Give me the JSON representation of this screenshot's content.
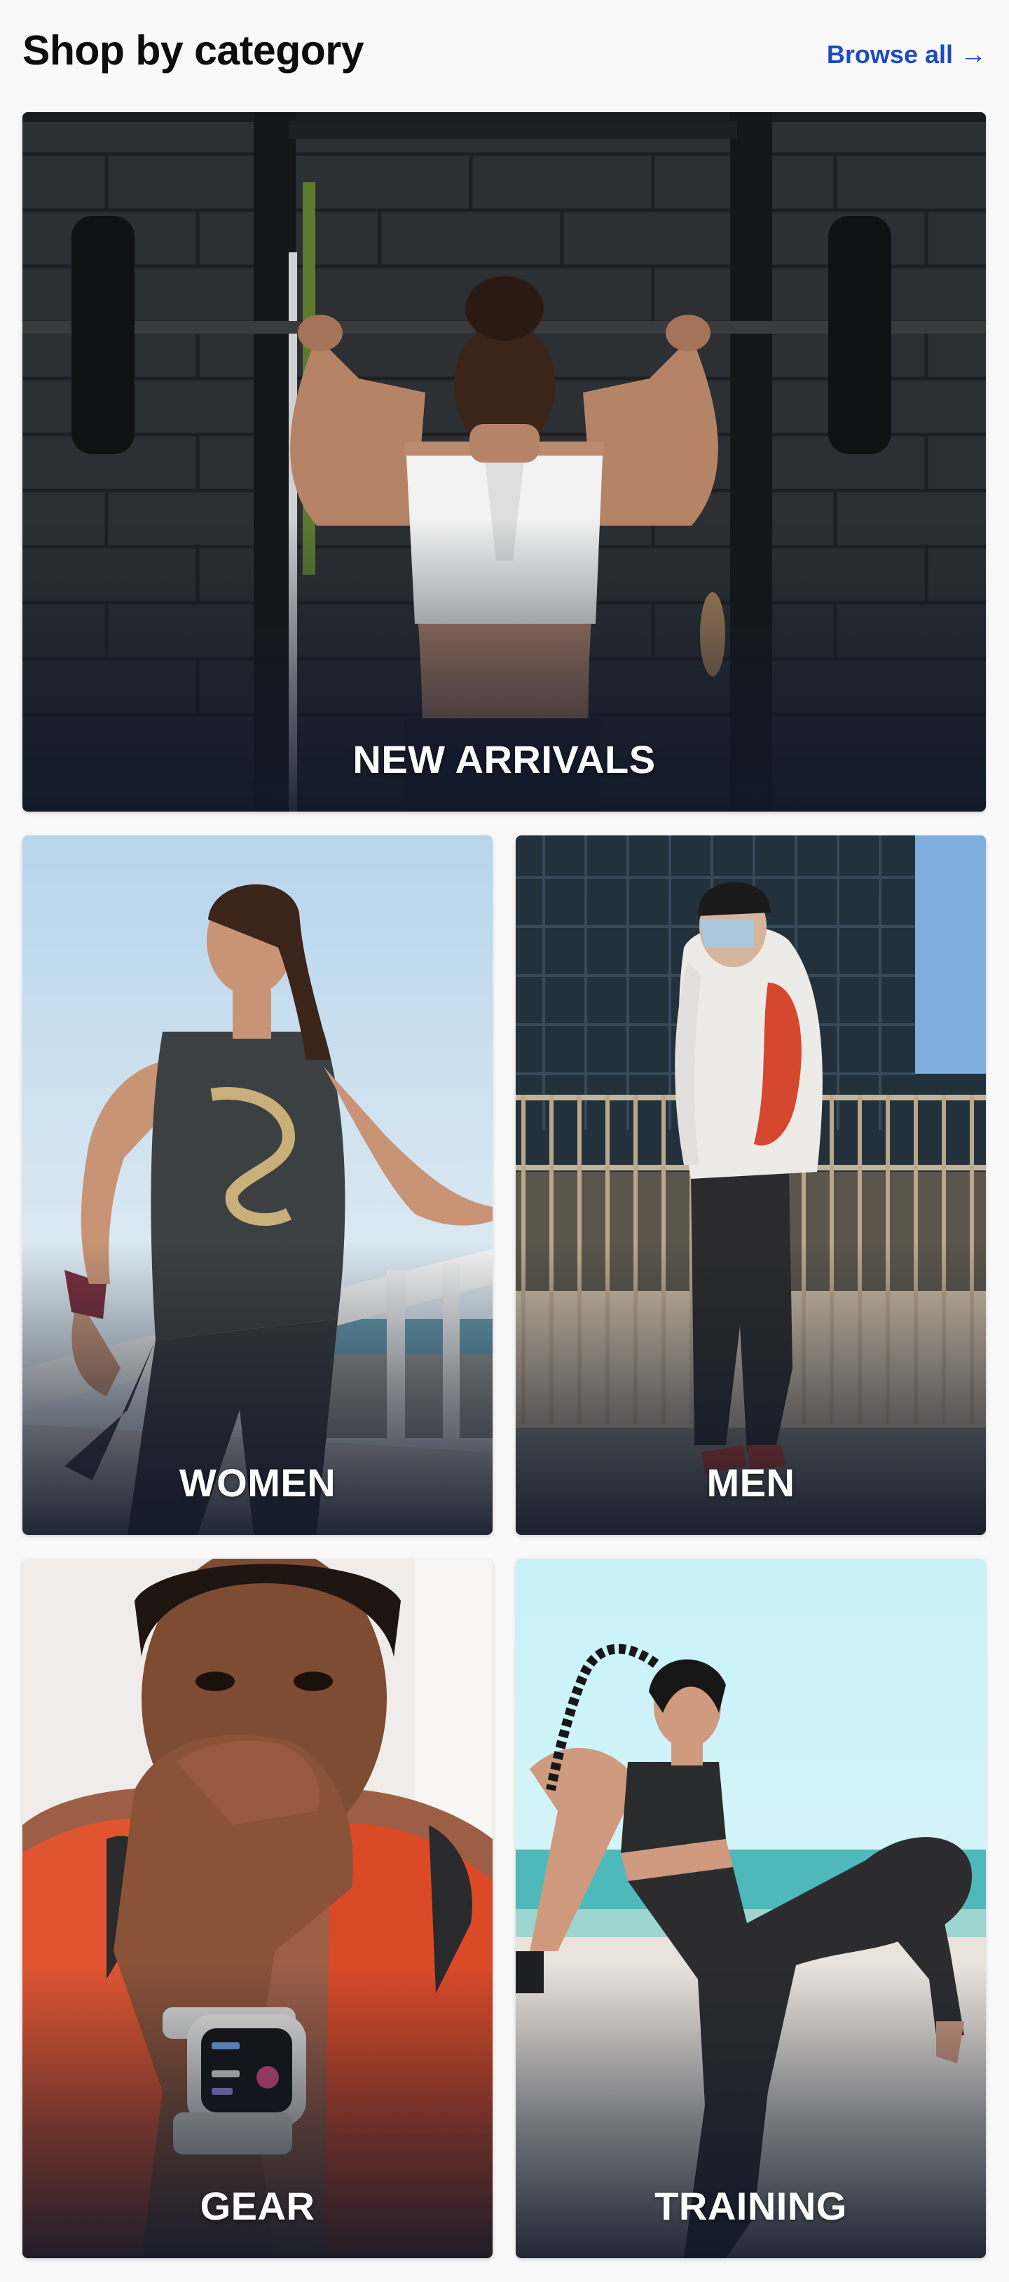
{
  "header": {
    "title": "Shop by category",
    "browse_label": "Browse all",
    "browse_arrow": "→",
    "accent_color": "#1d4bbf"
  },
  "categories": [
    {
      "id": "new-arrivals",
      "label": "NEW ARRIVALS",
      "image": "athlete-barbell-gym-photo"
    },
    {
      "id": "women",
      "label": "WOMEN",
      "image": "woman-stretching-seaside-photo"
    },
    {
      "id": "men",
      "label": "MEN",
      "image": "man-hoodie-balcony-photo"
    },
    {
      "id": "gear",
      "label": "GEAR",
      "image": "smartwatch-wrist-photo"
    },
    {
      "id": "training",
      "label": "TRAINING",
      "image": "woman-kick-beach-photo"
    }
  ]
}
